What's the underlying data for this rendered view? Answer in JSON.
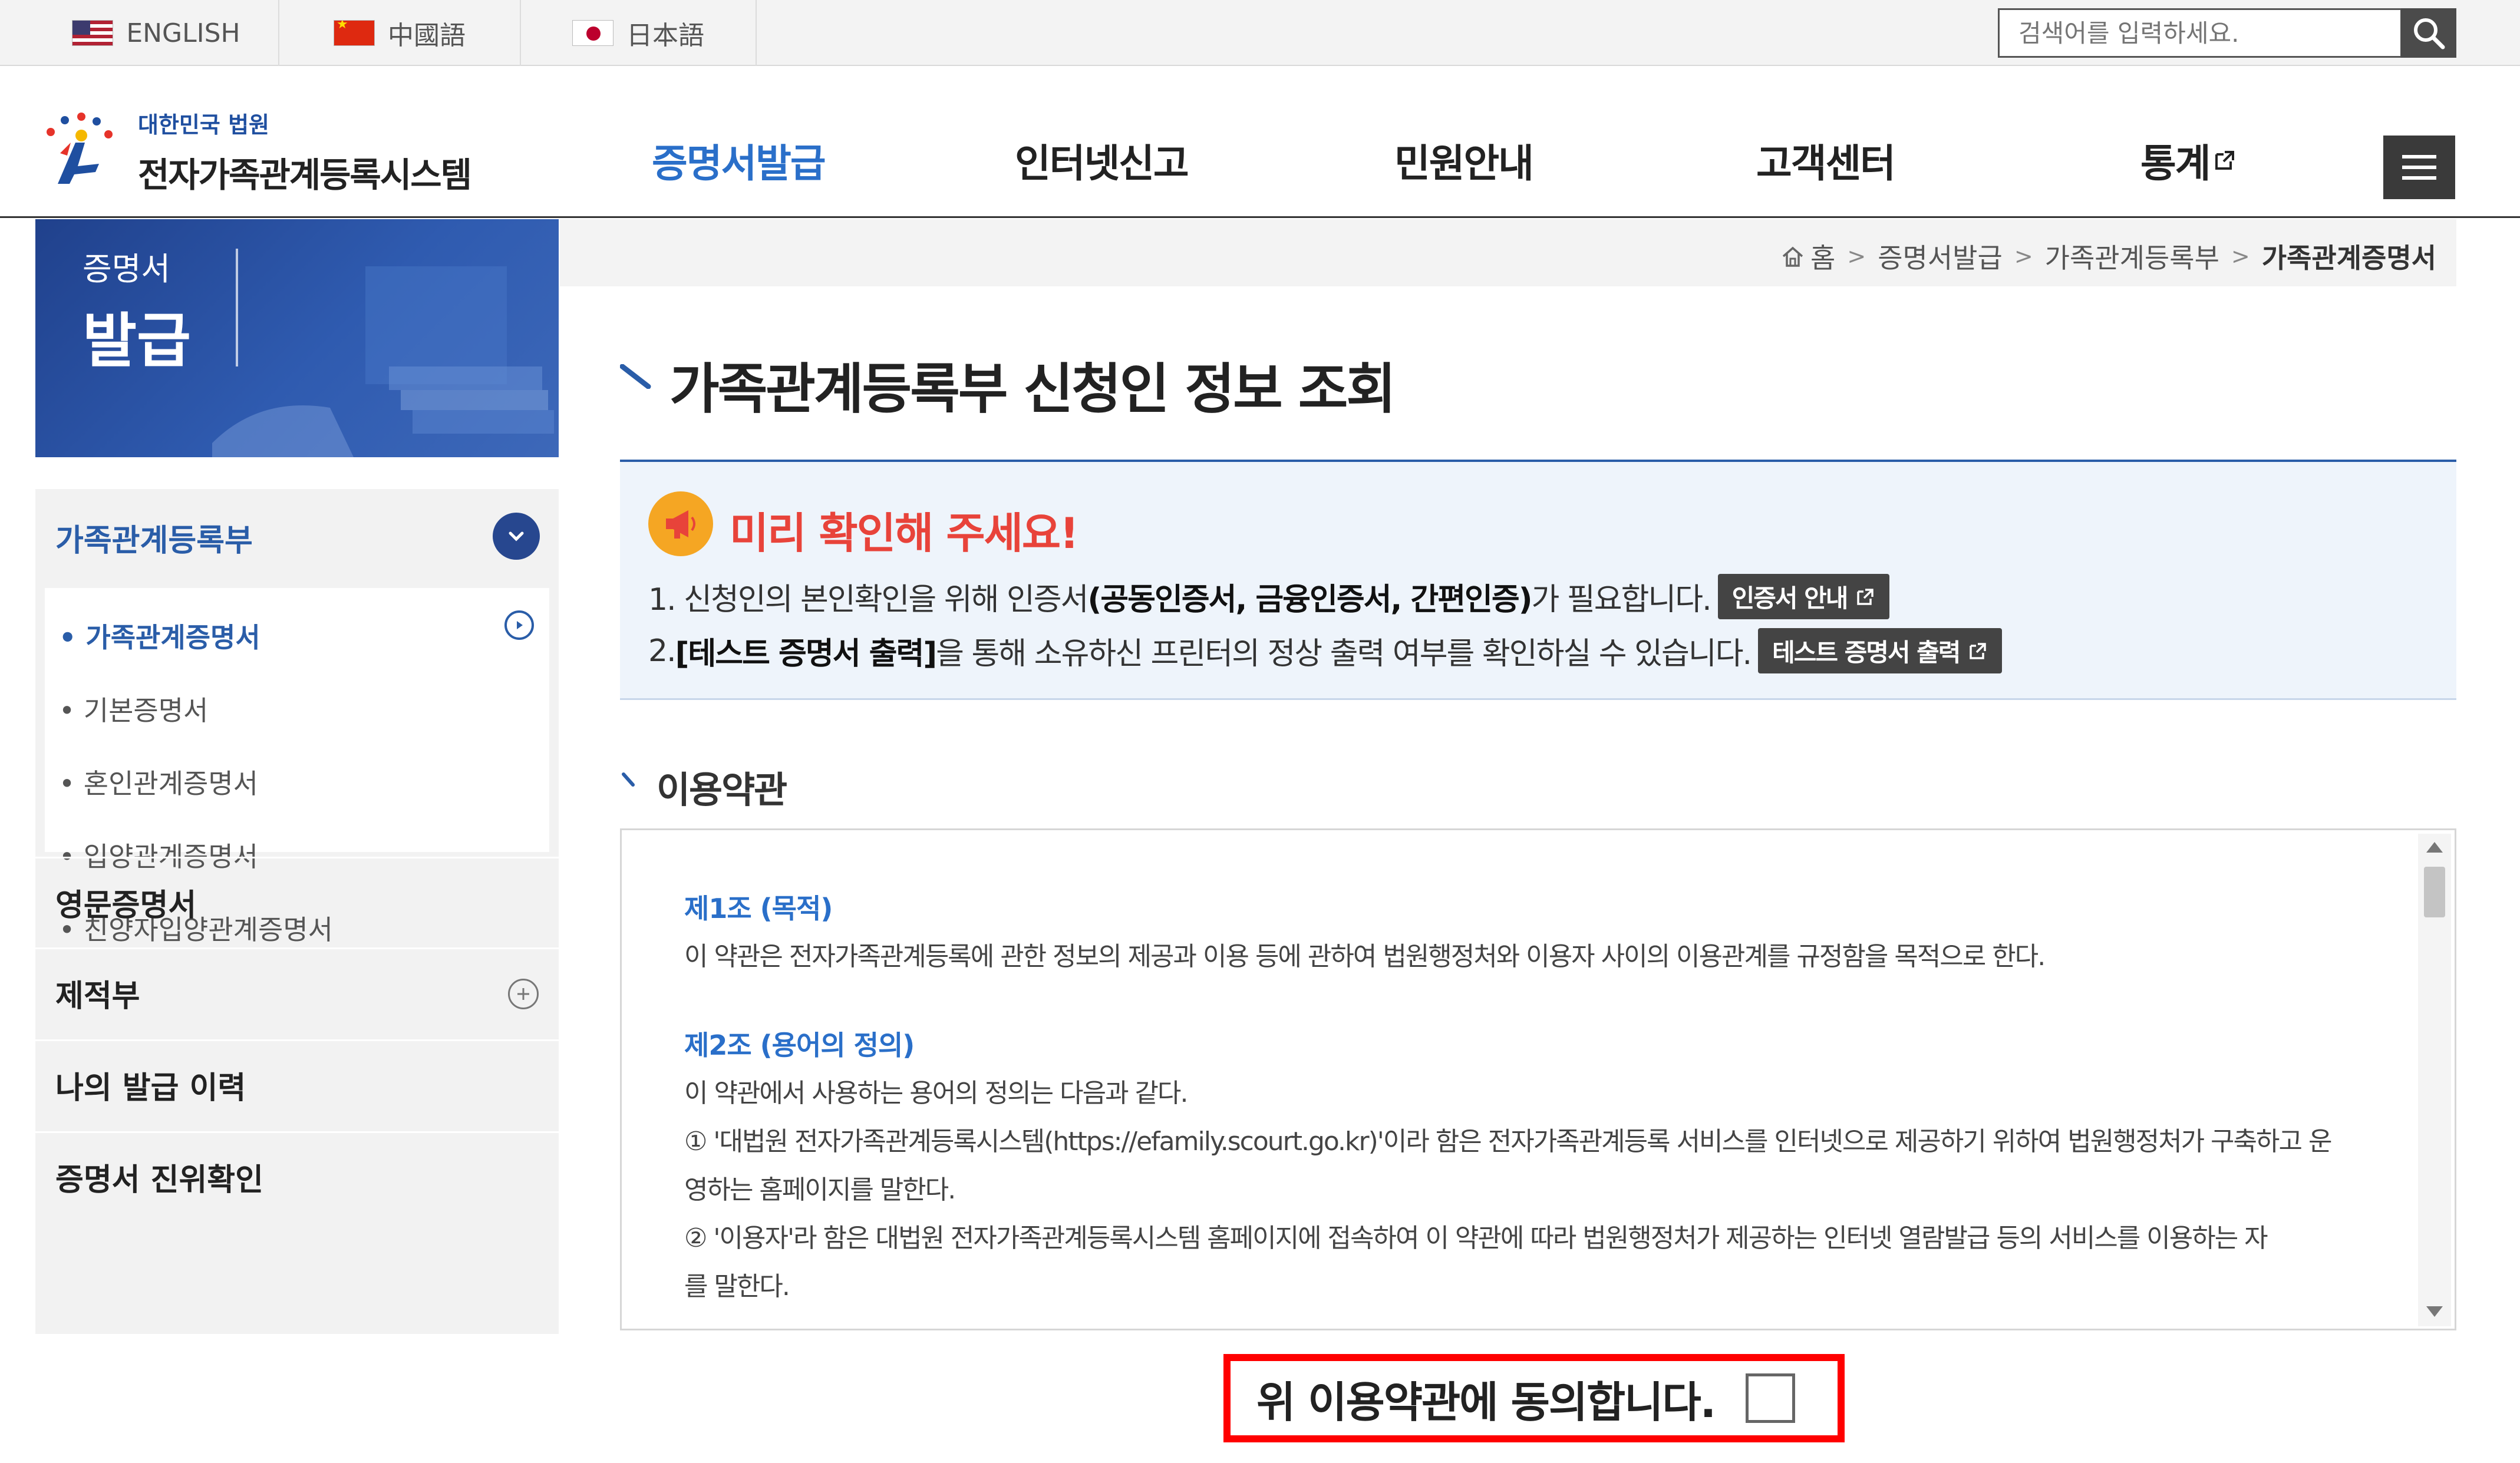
{
  "languages": [
    "ENGLISH",
    "中國語",
    "日本語"
  ],
  "search": {
    "placeholder": "검색어를 입력하세요."
  },
  "logo": {
    "small": "대한민국 법원",
    "big": "전자가족관계등록시스템"
  },
  "nav": {
    "items": [
      "증명서발급",
      "인터넷신고",
      "민원안내",
      "고객센터",
      "통계"
    ],
    "active": "증명서발급"
  },
  "sidebar": {
    "banner_line1": "증명서",
    "banner_line2": "발급",
    "section_title": "가족관계등록부",
    "sub_items": [
      "가족관계증명서",
      "기본증명서",
      "혼인관계증명서",
      "입양관계증명서",
      "친양자입양관계증명서"
    ],
    "items": [
      "영문증명서",
      "제적부",
      "나의 발급 이력",
      "증명서 진위확인"
    ]
  },
  "breadcrumb": [
    "홈",
    "증명서발급",
    "가족관계등록부",
    "가족관계증명서"
  ],
  "page_title": "가족관계등록부 신청인 정보 조회",
  "notice": {
    "title": "미리 확인해 주세요!",
    "line1_a": "1. 신청인의 본인확인을 위해 인증서",
    "line1_b": "(공동인증서, 금융인증서, 간편인증)",
    "line1_c": "가 필요합니다.",
    "button1": "인증서 안내",
    "line2_a": "2. ",
    "line2_b": "[테스트 증명서 출력]",
    "line2_c": "을 통해 소유하신 프린터의 정상 출력 여부를 확인하실 수 있습니다.",
    "button2": "테스트 증명서 출력"
  },
  "terms": {
    "section_title": "이용약관",
    "art1_title": "제1조 (목적)",
    "art1_text": "이 약관은 전자가족관계등록에 관한 정보의 제공과 이용 등에 관하여 법원행정처와 이용자 사이의 이용관계를 규정함을 목적으로 한다.",
    "art2_title": "제2조 (용어의 정의)",
    "art2_intro": "이 약관에서 사용하는 용어의 정의는 다음과 같다.",
    "art2_item1_a": "① '대법원 전자가족관계등록시스템(https://efamily.scourt.go.kr)'이라 함은 전자가족관계등록 서비스를 인터넷으로 제공하기 위하여 법원행정처가 구축하고 운",
    "art2_item1_b": "영하는 홈페이지를 말한다.",
    "art2_item2_a": "② '이용자'라 함은 대법원 전자가족관계등록시스템 홈페이지에 접속하여 이 약관에 따라 법원행정처가 제공하는 인터넷 열람발급 등의 서비스를 이용하는 자",
    "art2_item2_b": "를 말한다."
  },
  "agree": {
    "label": "위 이용약관에 동의합니다.",
    "checked": false
  },
  "colors": {
    "primary": "#2a5da8",
    "accent_red": "#e8433a",
    "highlight": "#ff0000",
    "banner": "#27478f"
  }
}
